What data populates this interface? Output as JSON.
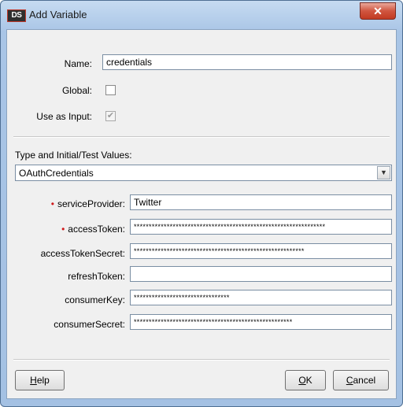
{
  "window": {
    "title": "Add Variable",
    "logo_text": "DS",
    "close_glyph": "✕"
  },
  "form": {
    "name_label": "Name:",
    "name_value": "credentials",
    "global_label": "Global:",
    "global_checked": false,
    "use_as_input_label": "Use as Input:",
    "use_as_input_checked": true,
    "use_as_input_glyph": "✔"
  },
  "type_section": {
    "label": "Type and Initial/Test Values:",
    "selected_type": "OAuthCredentials",
    "dropdown_glyph": "▼"
  },
  "fields": [
    {
      "label": "serviceProvider:",
      "value": "Twitter",
      "required": true
    },
    {
      "label": "accessToken:",
      "value": "****************************************************************",
      "required": true
    },
    {
      "label": "accessTokenSecret:",
      "value": "*********************************************************",
      "required": false
    },
    {
      "label": "refreshToken:",
      "value": "",
      "required": false
    },
    {
      "label": "consumerKey:",
      "value": "********************************",
      "required": false
    },
    {
      "label": "consumerSecret:",
      "value": "*****************************************************",
      "required": false
    }
  ],
  "required_marker": "•",
  "buttons": {
    "help_mnemonic": "H",
    "help_rest": "elp",
    "ok_mnemonic": "O",
    "ok_rest": "K",
    "cancel_mnemonic": "C",
    "cancel_rest": "ancel"
  },
  "colors": {
    "title_bar": "#a9c5e6",
    "close_button": "#c23a22",
    "required_marker": "#d0191b",
    "client_bg": "#f0f0f0"
  },
  "icons": {
    "logo": "ds-logo-icon",
    "close": "close-icon",
    "dropdown": "chevron-down-icon",
    "check": "checkmark-icon"
  }
}
